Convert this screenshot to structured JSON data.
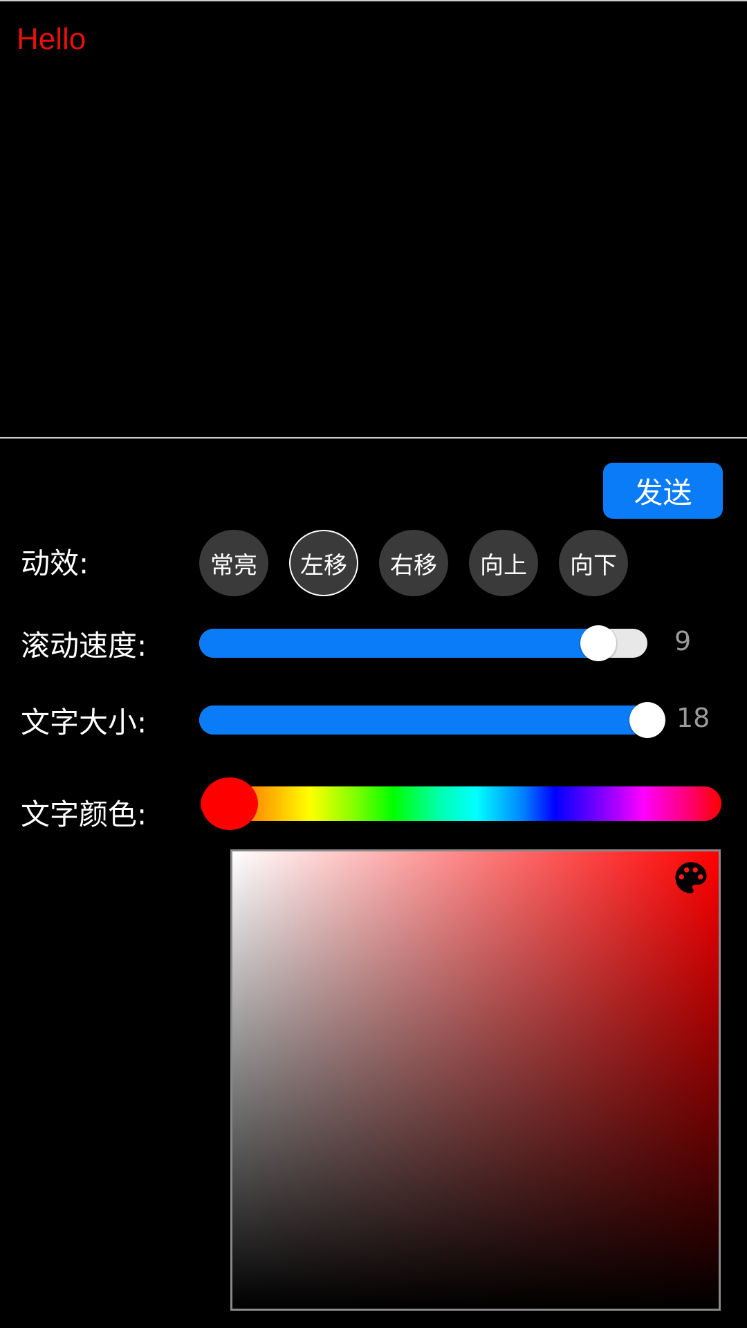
{
  "preview": {
    "text": "Hello",
    "text_color": "#e8100c"
  },
  "send_label": "发送",
  "effect": {
    "label": "动效:",
    "options": [
      "常亮",
      "左移",
      "右移",
      "向上",
      "向下"
    ],
    "selected": "左移"
  },
  "speed": {
    "label": "滚动速度:",
    "value": "9",
    "fraction": 0.89
  },
  "font_size": {
    "label": "文字大小:",
    "value": "18",
    "fraction": 1.0
  },
  "text_color": {
    "label": "文字颜色:",
    "hue_value": "#ff0000",
    "palette_icon": "palette-icon"
  },
  "colors": {
    "accent": "#0a7cf7",
    "button_bg": "#3a3a3a",
    "track_bg": "#e8e8e8"
  }
}
